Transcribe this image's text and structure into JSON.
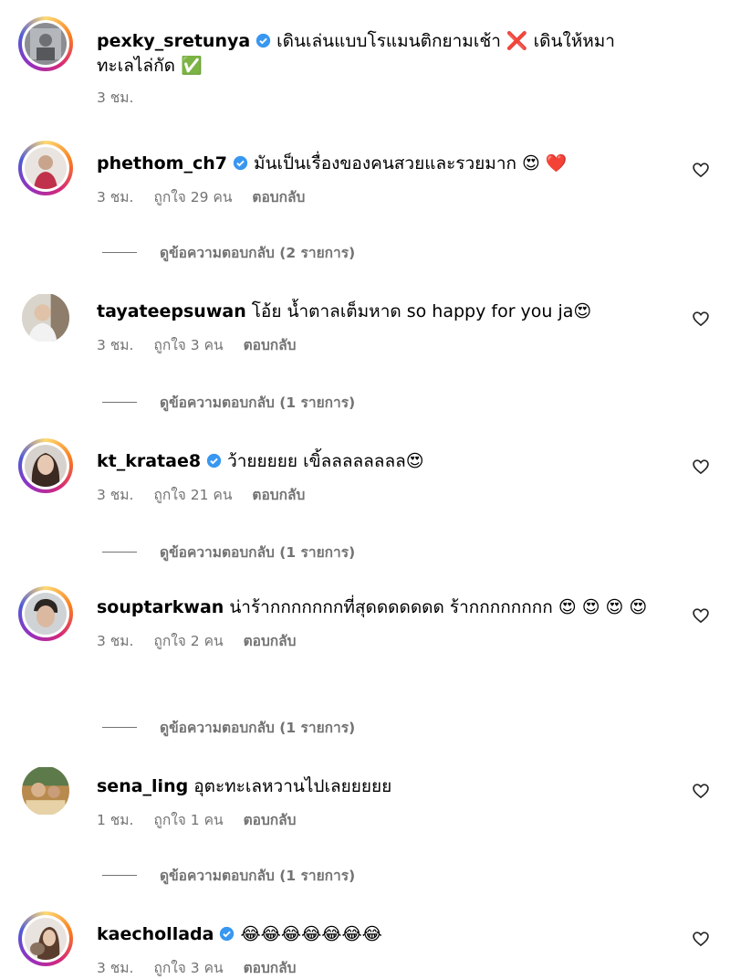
{
  "comments": [
    {
      "username": "pexky_sretunya",
      "verified": true,
      "text": "เดินเล่นแบบโรแมนติกยามเช้า ❌ เดินให้หมาทะเลไล่กัด ✅",
      "time": "3 ชม.",
      "likes": "",
      "reply": ""
    },
    {
      "username": "phethom_ch7",
      "verified": true,
      "text": "มันเป็นเรื่องของคนสวยและรวยมาก 😍 ❤️",
      "time": "3 ชม.",
      "likes": "ถูกใจ 29 คน",
      "reply": "ตอบกลับ",
      "view_replies": "ดูข้อความตอบกลับ (2 รายการ)"
    },
    {
      "username": "tayateepsuwan",
      "verified": false,
      "text": "โอ้ย น้ำตาลเต็มหาด so happy for you ja😍",
      "time": "3 ชม.",
      "likes": "ถูกใจ 3 คน",
      "reply": "ตอบกลับ",
      "view_replies": "ดูข้อความตอบกลับ (1 รายการ)"
    },
    {
      "username": "kt_kratae8",
      "verified": true,
      "text": "ว้ายยยยย เขิ้ลลลลลลลล😍",
      "time": "3 ชม.",
      "likes": "ถูกใจ 21 คน",
      "reply": "ตอบกลับ",
      "view_replies": "ดูข้อความตอบกลับ (1 รายการ)"
    },
    {
      "username": "souptarkwan",
      "verified": false,
      "text": "น่าร้ากกกกกกกที่สุดดดดดดด ร้ากกกกกกกก 😍 😍 😍 😍",
      "time": "3 ชม.",
      "likes": "ถูกใจ 2 คน",
      "reply": "ตอบกลับ",
      "view_replies": "ดูข้อความตอบกลับ (1 รายการ)"
    },
    {
      "username": "sena_ling",
      "verified": false,
      "text": "อุตะทะเลหวานไปเลยยยยย",
      "time": "1 ชม.",
      "likes": "ถูกใจ 1 คน",
      "reply": "ตอบกลับ",
      "view_replies": "ดูข้อความตอบกลับ (1 รายการ)"
    },
    {
      "username": "kaechollada",
      "verified": true,
      "text": "😂😂😂😂😂😂😂",
      "time": "3 ชม.",
      "likes": "ถูกใจ 3 คน",
      "reply": "ตอบกลับ"
    }
  ],
  "colors": {
    "verified": "#3897f0",
    "meta": "#737373",
    "heart_outline": "#262626"
  },
  "icons": {
    "verified": "verified-badge-icon",
    "like": "heart-outline-icon"
  }
}
